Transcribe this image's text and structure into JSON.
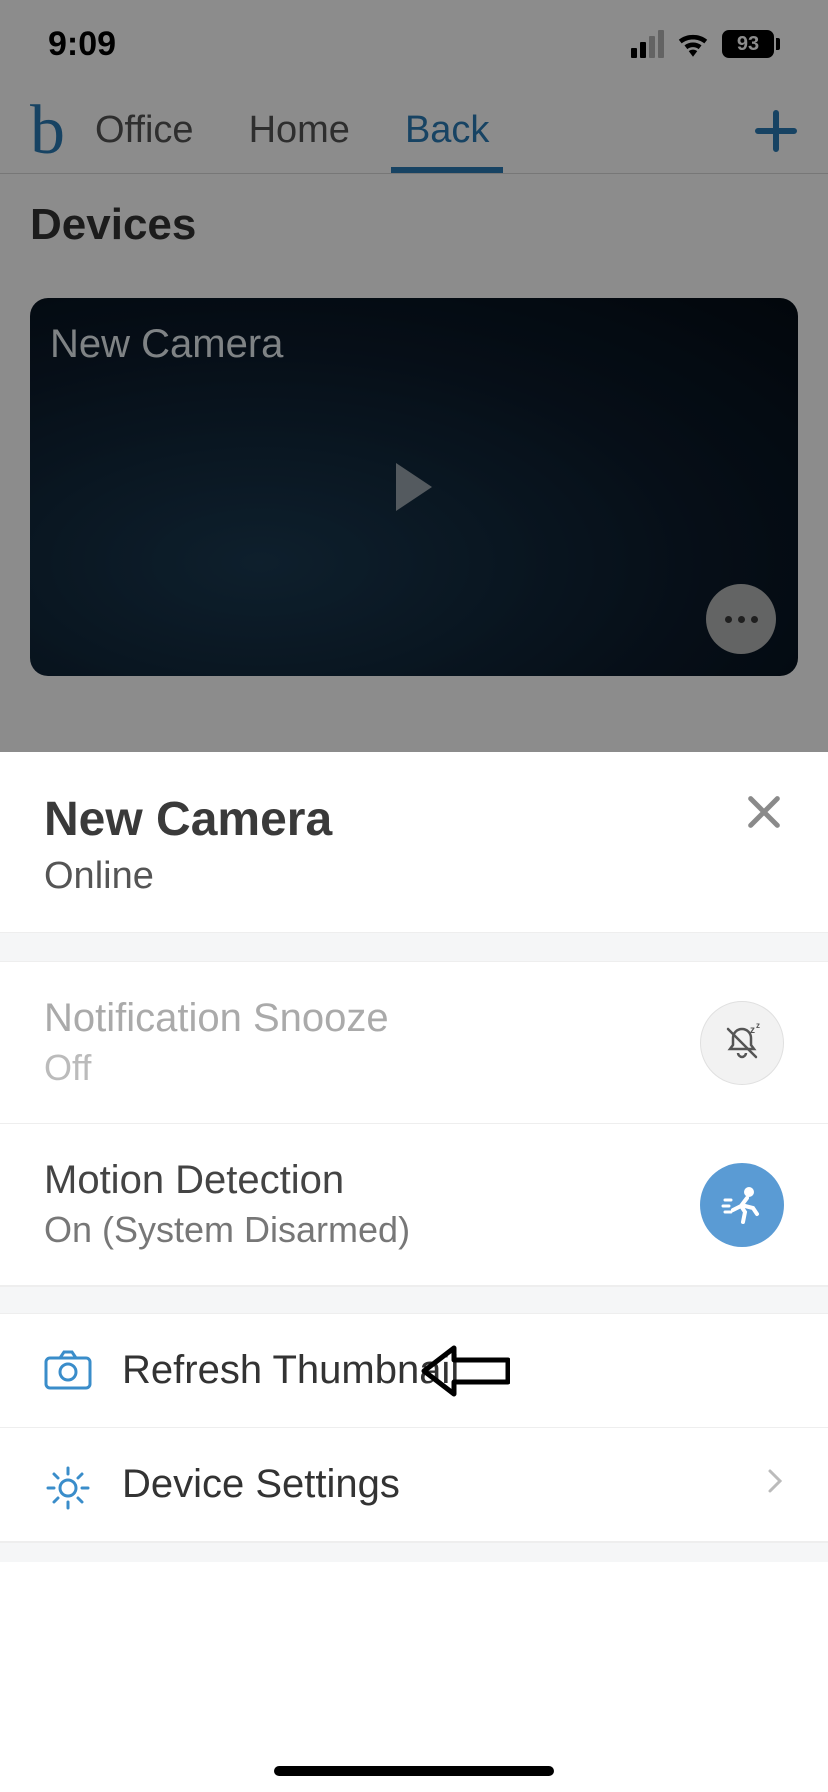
{
  "status": {
    "time": "9:09",
    "battery": "93"
  },
  "nav": {
    "logo": "b",
    "tabs": [
      {
        "label": "Office"
      },
      {
        "label": "Home"
      },
      {
        "label": "Back"
      }
    ]
  },
  "devices": {
    "heading": "Devices"
  },
  "camera_card": {
    "name": "New Camera"
  },
  "sheet": {
    "title": "New Camera",
    "status": "Online",
    "snooze": {
      "title": "Notification Snooze",
      "value": "Off"
    },
    "motion": {
      "title": "Motion Detection",
      "value": "On (System Disarmed)"
    },
    "refresh": {
      "label": "Refresh Thumbnail"
    },
    "settings": {
      "label": "Device Settings"
    }
  }
}
